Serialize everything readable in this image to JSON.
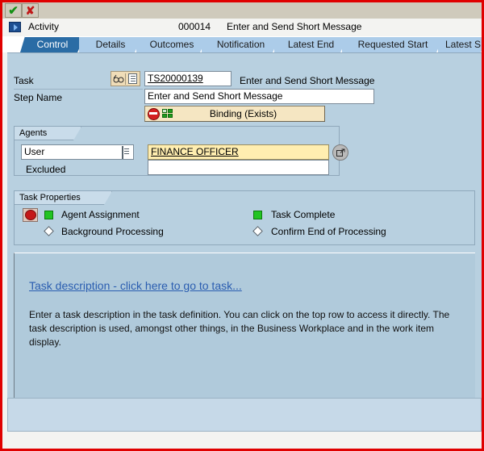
{
  "toolbar": {
    "confirm_label": "✔",
    "cancel_label": "✘"
  },
  "header": {
    "type_label": "Activity",
    "number": "000014",
    "title": "Enter and Send Short Message"
  },
  "tabs": [
    {
      "label": "Control",
      "active": true
    },
    {
      "label": "Details",
      "active": false
    },
    {
      "label": "Outcomes",
      "active": false
    },
    {
      "label": "Notification",
      "active": false
    },
    {
      "label": "Latest End",
      "active": false
    },
    {
      "label": "Requested Start",
      "active": false
    },
    {
      "label": "Latest S",
      "active": false
    }
  ],
  "task": {
    "label": "Task",
    "id_value": "TS20000139",
    "description": "Enter and Send Short Message",
    "step_name_label": "Step Name",
    "step_name_value": "Enter and Send Short Message",
    "binding_label": "Binding (Exists)"
  },
  "agents": {
    "section_title": "Agents",
    "type_value": "User",
    "user_value": "FINANCE OFFICER",
    "excluded_label": "Excluded",
    "excluded_value": ""
  },
  "task_properties": {
    "section_title": "Task Properties",
    "items": [
      {
        "label": "Agent Assignment",
        "state": "on"
      },
      {
        "label": "Background Processing",
        "state": "off"
      },
      {
        "label": "Task Complete",
        "state": "on"
      },
      {
        "label": "Confirm End of Processing",
        "state": "off"
      }
    ]
  },
  "description": {
    "link_text": "Task description - click here to go to task...",
    "body_text": "Enter a task description in the task definition. You can click on the top row to access it directly. The task description is used, amongst other things, in the Business Workplace and in the work item display."
  },
  "colors": {
    "window_border": "#e00000",
    "tab_active": "#2a6ca5",
    "tab_inactive": "#accce9",
    "panel_bg": "#b8d0e0",
    "field_highlight": "#ffeeb0",
    "link": "#2a5db0",
    "marker_on": "#22c422"
  }
}
